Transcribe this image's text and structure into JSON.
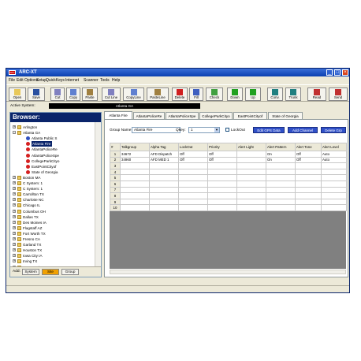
{
  "window": {
    "title": "ARC-XT",
    "app_icon_text": "ARC"
  },
  "menu": [
    "File",
    "Edit",
    "Options",
    "Setup",
    "QuickKeys",
    "Internet",
    "Scanner",
    "Tools",
    "Help"
  ],
  "toolbar": [
    {
      "label": "Open",
      "icon": "folder-open-icon",
      "color": "#e8c85a"
    },
    {
      "label": "Save",
      "icon": "floppy-icon",
      "color": "#2a50a0"
    },
    {
      "label": "Cut",
      "icon": "scissors-icon",
      "color": "#8080c0"
    },
    {
      "label": "Copy",
      "icon": "copy-icon",
      "color": "#6080d0"
    },
    {
      "label": "Paste",
      "icon": "paste-icon",
      "color": "#a08040"
    },
    {
      "label": "Cut Line",
      "icon": "cut-line-icon",
      "color": "#8080c0"
    },
    {
      "label": "CopyLine",
      "icon": "copy-line-icon",
      "color": "#6080d0"
    },
    {
      "label": "PasteLine",
      "icon": "paste-line-icon",
      "color": "#a08040"
    },
    {
      "label": "Delete",
      "icon": "delete-icon",
      "color": "#d02020"
    },
    {
      "label": "Fill",
      "icon": "fill-icon",
      "color": "#4060c0"
    },
    {
      "label": "Check",
      "icon": "check-icon",
      "color": "#40a040"
    },
    {
      "label": "Down",
      "icon": "arrow-down-icon",
      "color": "#20a020"
    },
    {
      "label": "Up",
      "icon": "arrow-up-icon",
      "color": "#20a020"
    },
    {
      "label": "Conv.",
      "icon": "convert-icon",
      "color": "#208080"
    },
    {
      "label": "Trunk",
      "icon": "trunk-icon",
      "color": "#208080"
    },
    {
      "label": "Read",
      "icon": "read-icon",
      "color": "#c03030"
    },
    {
      "label": "Send",
      "icon": "send-icon",
      "color": "#c03030"
    }
  ],
  "active_system": {
    "label": "Active System:",
    "value": "Atlanta GA"
  },
  "browser": {
    "title": "Browser:",
    "tree": [
      {
        "label": "Arlington",
        "level": 0,
        "kind": "folder",
        "pm": "+"
      },
      {
        "label": "Atlanta GA",
        "level": 0,
        "kind": "folder",
        "pm": "-"
      },
      {
        "label": "Atlanta Public S",
        "level": 1,
        "kind": "site"
      },
      {
        "label": "Atlanta Fire",
        "level": 1,
        "kind": "grp",
        "selected": true
      },
      {
        "label": "AtlantaPoliceRe",
        "level": 1,
        "kind": "grp"
      },
      {
        "label": "AtlantaPoliceSpe",
        "level": 1,
        "kind": "grp"
      },
      {
        "label": "CollegeParkCityo",
        "level": 1,
        "kind": "grp"
      },
      {
        "label": "EastPointCityof",
        "level": 1,
        "kind": "grp"
      },
      {
        "label": "State of Georgia",
        "level": 1,
        "kind": "grp"
      },
      {
        "label": "Boston MA",
        "level": 0,
        "kind": "folder",
        "pm": "+"
      },
      {
        "label": "C System: 1",
        "level": 0,
        "kind": "folder",
        "pm": "+"
      },
      {
        "label": "C System: 1",
        "level": 0,
        "kind": "folder",
        "pm": "+"
      },
      {
        "label": "Carrollton TX",
        "level": 0,
        "kind": "folder",
        "pm": "+"
      },
      {
        "label": "Charlotte NC",
        "level": 0,
        "kind": "folder",
        "pm": "+"
      },
      {
        "label": "Chicago IL",
        "level": 0,
        "kind": "folder",
        "pm": "+"
      },
      {
        "label": "Columbus OH",
        "level": 0,
        "kind": "folder",
        "pm": "+"
      },
      {
        "label": "Dallas TX",
        "level": 0,
        "kind": "folder",
        "pm": "+"
      },
      {
        "label": "Des Moines IA",
        "level": 0,
        "kind": "folder",
        "pm": "+"
      },
      {
        "label": "Flagstaff AZ",
        "level": 0,
        "kind": "folder",
        "pm": "+"
      },
      {
        "label": "Fort Worth TX",
        "level": 0,
        "kind": "folder",
        "pm": "+"
      },
      {
        "label": "Fresno CA",
        "level": 0,
        "kind": "folder",
        "pm": "+"
      },
      {
        "label": "Garland TX",
        "level": 0,
        "kind": "folder",
        "pm": "+"
      },
      {
        "label": "Houston TX",
        "level": 0,
        "kind": "folder",
        "pm": "+"
      },
      {
        "label": "Iowa City IA",
        "level": 0,
        "kind": "folder",
        "pm": "+"
      },
      {
        "label": "Irving TX",
        "level": 0,
        "kind": "folder",
        "pm": "+"
      },
      {
        "label": "Kansas City MO",
        "level": 0,
        "kind": "folder",
        "pm": "+"
      }
    ],
    "add_label": "Add:",
    "add_buttons": [
      "System",
      "Site",
      "Group"
    ]
  },
  "tabs": [
    "Atlanta Fire",
    "AtlantaPoliceRe",
    "AtlantaPoliceSpe",
    "CollegeParkCityo",
    "EastPointCityof",
    "State of Georgia"
  ],
  "form": {
    "group_name_label": "Group Name:",
    "group_name_value": "Atlanta Fire",
    "qkey_label": "Qkey:",
    "qkey_value": "1",
    "lockout_label": "LockOut",
    "buttons": [
      "Edit GPS Data",
      "Add Channel",
      "Delete Grp"
    ]
  },
  "table": {
    "columns": [
      "#",
      "Talkgroup",
      "Alpha Tag",
      "LockOut",
      "Priority",
      "Alert Light",
      "Alert Pattern",
      "Alert Tone",
      "Alert Level"
    ],
    "rows": [
      [
        "1",
        "34672",
        "AFD Dispatch",
        "Off",
        "Off",
        "",
        "On",
        "Off",
        "Auto"
      ],
      [
        "2",
        "34960",
        "AFD MED 1",
        "Off",
        "Off",
        "",
        "On",
        "Off",
        "Auto"
      ],
      [
        "3",
        "",
        "",
        "",
        "",
        "",
        "",
        "",
        ""
      ],
      [
        "4",
        "",
        "",
        "",
        "",
        "",
        "",
        "",
        ""
      ],
      [
        "5",
        "",
        "",
        "",
        "",
        "",
        "",
        "",
        ""
      ],
      [
        "6",
        "",
        "",
        "",
        "",
        "",
        "",
        "",
        ""
      ],
      [
        "7",
        "",
        "",
        "",
        "",
        "",
        "",
        "",
        ""
      ],
      [
        "8",
        "",
        "",
        "",
        "",
        "",
        "",
        "",
        ""
      ],
      [
        "9",
        "",
        "",
        "",
        "",
        "",
        "",
        "",
        ""
      ],
      [
        "10",
        "",
        "",
        "",
        "",
        "",
        "",
        "",
        ""
      ]
    ]
  }
}
